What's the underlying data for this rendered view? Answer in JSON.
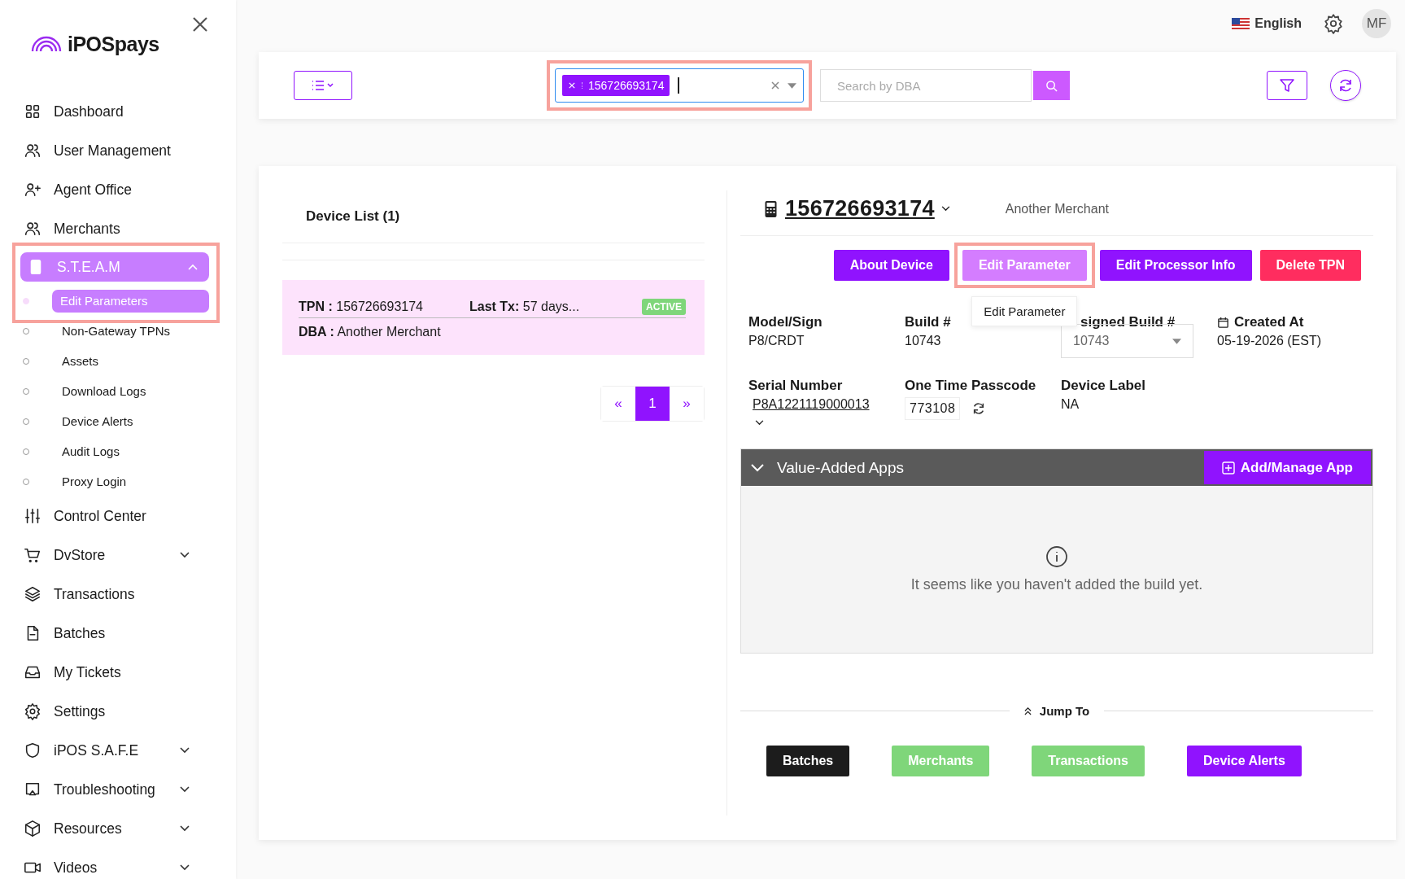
{
  "logo": {
    "text": "iPOSpays"
  },
  "sidebar": {
    "items": [
      {
        "label": "Dashboard",
        "selected": false
      },
      {
        "label": "User Management",
        "selected": false
      },
      {
        "label": "Agent Office",
        "selected": false
      },
      {
        "label": "Merchants",
        "selected": false
      },
      {
        "label": "S.T.E.A.M",
        "selected": true,
        "expanded": true,
        "highlighted": true,
        "children": [
          {
            "label": "Edit Parameters",
            "selected": true
          },
          {
            "label": "Non-Gateway TPNs",
            "selected": false
          },
          {
            "label": "Assets",
            "selected": false
          },
          {
            "label": "Download Logs",
            "selected": false
          },
          {
            "label": "Device Alerts",
            "selected": false
          },
          {
            "label": "Audit Logs",
            "selected": false
          },
          {
            "label": "Proxy Login",
            "selected": false
          }
        ]
      },
      {
        "label": "Control Center",
        "selected": false
      },
      {
        "label": "DvStore",
        "selected": false,
        "expanded": false
      },
      {
        "label": "Transactions",
        "selected": false
      },
      {
        "label": "Batches",
        "selected": false
      },
      {
        "label": "My Tickets",
        "selected": false
      },
      {
        "label": "Settings",
        "selected": false
      },
      {
        "label": "iPOS S.A.F.E",
        "selected": false,
        "expanded": false
      },
      {
        "label": "Troubleshooting",
        "selected": false,
        "expanded": false
      },
      {
        "label": "Resources",
        "selected": false,
        "expanded": false
      },
      {
        "label": "Videos",
        "selected": false,
        "expanded": false
      }
    ]
  },
  "header": {
    "language": "English",
    "avatar": "MF"
  },
  "toolbar": {
    "tpn_select": {
      "tags": [
        "156726693174"
      ],
      "highlighted": true
    },
    "dba_search": {
      "placeholder": "Search by DBA"
    }
  },
  "device_list": {
    "title": "Device List (1)",
    "devices": [
      {
        "tpn_label": "TPN :",
        "tpn": "156726693174",
        "last_tx_label": "Last Tx:",
        "last_tx": "57 days...",
        "dba_label": "DBA :",
        "dba": "Another Merchant",
        "status": "ACTIVE",
        "selected": true
      }
    ],
    "pagination": {
      "prev": "«",
      "pages": [
        {
          "label": "1",
          "selected": true
        }
      ],
      "next": "»"
    }
  },
  "device": {
    "tpn": "156726693174",
    "merchant": "Another Merchant",
    "actions": [
      {
        "label": "About Device",
        "kind": "primary",
        "hovered": false,
        "highlighted": false
      },
      {
        "label": "Edit Parameter",
        "kind": "primary",
        "hovered": true,
        "highlighted": true,
        "tooltip": "Edit Parameter"
      },
      {
        "label": "Edit Processor Info",
        "kind": "primary",
        "hovered": false,
        "highlighted": false
      },
      {
        "label": "Delete TPN",
        "kind": "danger",
        "hovered": false,
        "highlighted": false
      }
    ],
    "fields": [
      {
        "label": "Model/Sign",
        "value": "P8/CRDT",
        "kind": "text"
      },
      {
        "label": "Build #",
        "value": "10743",
        "kind": "text"
      },
      {
        "label": "signed Build #",
        "value": "10743",
        "kind": "select"
      },
      {
        "label": "Created At",
        "value": "05-19-2026 (EST)",
        "kind": "date"
      },
      {
        "label": "Serial Number",
        "value": "P8A1221119000013",
        "kind": "link"
      },
      {
        "label": "One Time Passcode",
        "value": "773108",
        "kind": "passcode"
      },
      {
        "label": "Device Label",
        "value": "NA",
        "kind": "text"
      }
    ],
    "apps_panel": {
      "title": "Value-Added Apps",
      "expanded": true,
      "add_button": "Add/Manage App",
      "empty_message": "It seems like you haven't added the build yet."
    },
    "jump_to": {
      "label": "Jump To",
      "links": [
        {
          "label": "Batches",
          "color": "#1c1c1c"
        },
        {
          "label": "Merchants",
          "color": "#7fd67a"
        },
        {
          "label": "Transactions",
          "color": "#7fd67a"
        },
        {
          "label": "Device Alerts",
          "color": "#9013fe"
        }
      ]
    }
  }
}
